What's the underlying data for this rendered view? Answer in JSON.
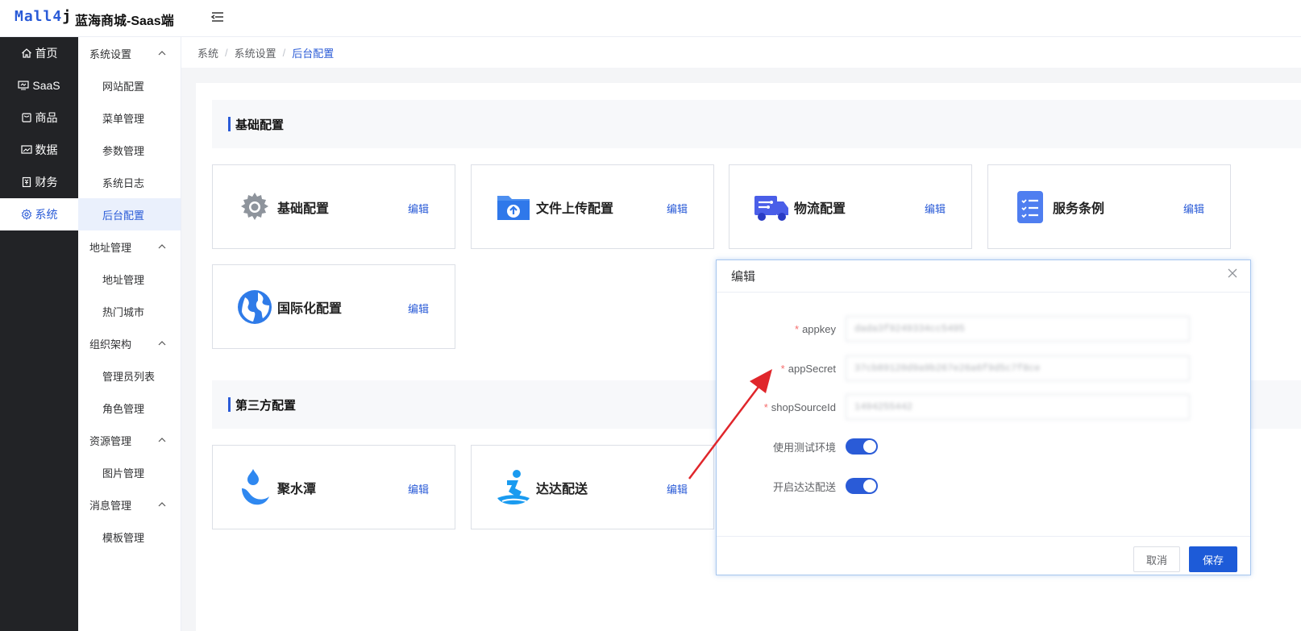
{
  "header": {
    "logo_main": "Mall4",
    "logo_tail": "j",
    "title": "蓝海商城-Saas端"
  },
  "main_nav": [
    {
      "label": "首页",
      "icon": "home-icon"
    },
    {
      "label": "SaaS",
      "icon": "monitor-icon"
    },
    {
      "label": "商品",
      "icon": "bag-icon"
    },
    {
      "label": "数据",
      "icon": "chart-icon"
    },
    {
      "label": "财务",
      "icon": "receipt-icon"
    },
    {
      "label": "系统",
      "icon": "gear-icon",
      "active": true
    }
  ],
  "sub_nav": {
    "groups": [
      {
        "title": "系统设置",
        "items": [
          "网站配置",
          "菜单管理",
          "参数管理",
          "系统日志",
          "后台配置"
        ]
      },
      {
        "title": "地址管理",
        "items": [
          "地址管理",
          "热门城市"
        ]
      },
      {
        "title": "组织架构",
        "items": [
          "管理员列表",
          "角色管理"
        ]
      },
      {
        "title": "资源管理",
        "items": [
          "图片管理"
        ]
      },
      {
        "title": "消息管理",
        "items": [
          "模板管理"
        ]
      }
    ],
    "active_item": "后台配置"
  },
  "breadcrumb": [
    "系统",
    "系统设置",
    "后台配置"
  ],
  "sections": {
    "basic": {
      "title": "基础配置",
      "cards": [
        {
          "name": "基础配置",
          "icon": "gear-icon",
          "edit": "编辑"
        },
        {
          "name": "文件上传配置",
          "icon": "folder-upload-icon",
          "edit": "编辑"
        },
        {
          "name": "物流配置",
          "icon": "truck-icon",
          "edit": "编辑"
        },
        {
          "name": "服务条例",
          "icon": "document-list-icon",
          "edit": "编辑"
        },
        {
          "name": "国际化配置",
          "icon": "globe-icon",
          "edit": "编辑"
        }
      ]
    },
    "third": {
      "title": "第三方配置",
      "cards": [
        {
          "name": "聚水潭",
          "icon": "water-drop-icon",
          "edit": "编辑"
        },
        {
          "name": "达达配送",
          "icon": "rider-icon",
          "edit": "编辑"
        }
      ]
    }
  },
  "dialog": {
    "title": "编辑",
    "fields": [
      {
        "label": "appkey",
        "required": true,
        "value": "dada3f9249334cc5495"
      },
      {
        "label": "appSecret",
        "required": true,
        "value": "37cb89120d9a9b267e26a6f9d5c7f8ce"
      },
      {
        "label": "shopSourceId",
        "required": true,
        "value": "1494255442"
      }
    ],
    "switches": [
      {
        "label": "使用测试环境",
        "on": true
      },
      {
        "label": "开启达达配送",
        "on": true
      }
    ],
    "cancel": "取消",
    "save": "保存"
  },
  "colors": {
    "accent": "#2a5bd7",
    "sidebar_dark": "#222326",
    "required": "#f56c6c",
    "arrow": "#e0262b"
  }
}
